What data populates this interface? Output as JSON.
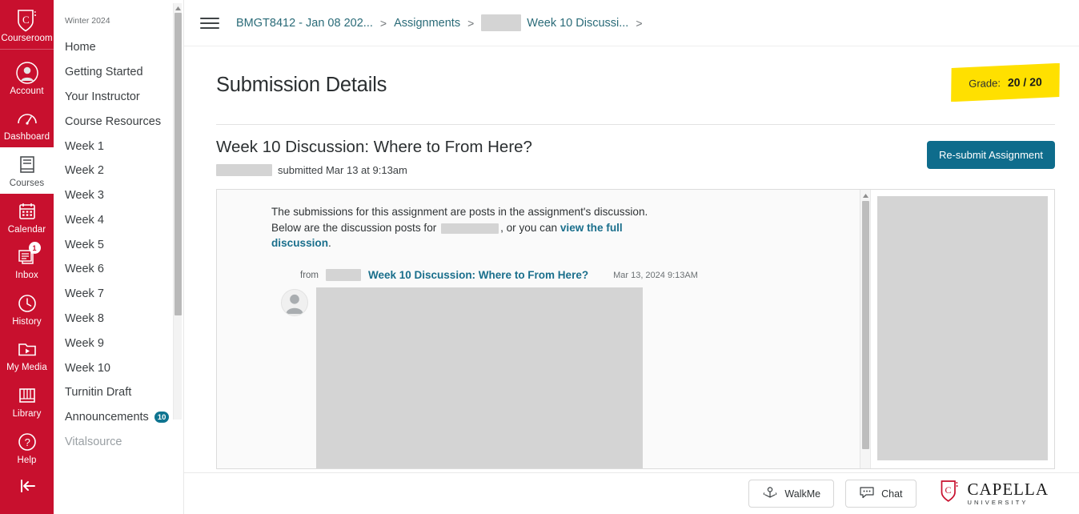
{
  "global_nav": {
    "items": [
      {
        "label": "Courseroom",
        "icon": "shield-logo-icon",
        "active": false,
        "badge": null
      },
      {
        "label": "Account",
        "icon": "user-circle-icon",
        "active": false,
        "badge": null
      },
      {
        "label": "Dashboard",
        "icon": "gauge-icon",
        "active": false,
        "badge": null
      },
      {
        "label": "Courses",
        "icon": "book-icon",
        "active": true,
        "badge": null
      },
      {
        "label": "Calendar",
        "icon": "calendar-icon",
        "active": false,
        "badge": null
      },
      {
        "label": "Inbox",
        "icon": "inbox-icon",
        "active": false,
        "badge": "1"
      },
      {
        "label": "History",
        "icon": "clock-icon",
        "active": false,
        "badge": null
      },
      {
        "label": "My Media",
        "icon": "video-folder-icon",
        "active": false,
        "badge": null
      },
      {
        "label": "Library",
        "icon": "library-books-icon",
        "active": false,
        "badge": null
      },
      {
        "label": "Help",
        "icon": "question-circle-icon",
        "active": false,
        "badge": null
      }
    ],
    "collapse_icon": "collapse-left-icon"
  },
  "course_nav": {
    "term": "Winter 2024",
    "items": [
      {
        "label": "Home",
        "badge": null
      },
      {
        "label": "Getting Started",
        "badge": null
      },
      {
        "label": "Your Instructor",
        "badge": null
      },
      {
        "label": "Course Resources",
        "badge": null
      },
      {
        "label": "Week 1",
        "badge": null
      },
      {
        "label": "Week 2",
        "badge": null
      },
      {
        "label": "Week 3",
        "badge": null
      },
      {
        "label": "Week 4",
        "badge": null
      },
      {
        "label": "Week 5",
        "badge": null
      },
      {
        "label": "Week 6",
        "badge": null
      },
      {
        "label": "Week 7",
        "badge": null
      },
      {
        "label": "Week 8",
        "badge": null
      },
      {
        "label": "Week 9",
        "badge": null
      },
      {
        "label": "Week 10",
        "badge": null
      },
      {
        "label": "Turnitin Draft",
        "badge": null
      },
      {
        "label": "Announcements",
        "badge": "10"
      },
      {
        "label": "Vitalsource",
        "badge": null
      }
    ]
  },
  "breadcrumb": {
    "menu_icon": "hamburger-menu-icon",
    "course": "BMGT8412 - Jan 08 202...",
    "section": "Assignments",
    "redacted": true,
    "page": "Week 10 Discussi...",
    "separator": ">"
  },
  "main": {
    "page_title": "Submission Details",
    "grade": {
      "label": "Grade:",
      "value": "20 / 20",
      "highlight_color": "#FFE000"
    },
    "assignment": {
      "title": "Week 10 Discussion: Where to From Here?",
      "submitted_text": "submitted Mar 13 at 9:13am",
      "resubmit_label": "Re-submit Assignment",
      "resubmit_color": "#0E6C8C"
    },
    "preview": {
      "intro_part1": "The submissions for this assignment are posts in the assignment's discussion. Below are the discussion posts for",
      "intro_part2": ", or you can",
      "intro_link": "view the full discussion",
      "intro_end": ".",
      "post": {
        "from_label": "from",
        "title": "Week 10 Discussion: Where to From Here?",
        "date": "Mar 13, 2024 9:13AM",
        "avatar_icon": "default-avatar-icon"
      }
    }
  },
  "footer": {
    "walkme_label": "WalkMe",
    "walkme_icon": "walkme-icon",
    "chat_label": "Chat",
    "chat_icon": "chat-bubble-icon",
    "logo_name": "CAPELLA",
    "logo_sub": "UNIVERSITY",
    "logo_icon": "capella-shield-icon"
  }
}
